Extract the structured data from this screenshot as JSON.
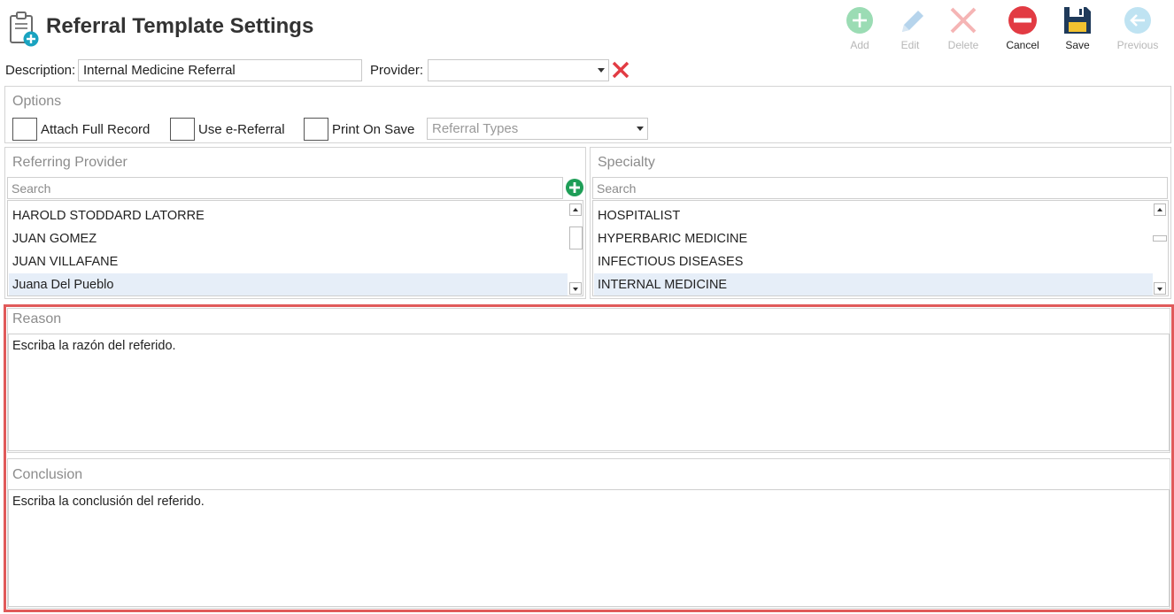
{
  "header": {
    "title": "Referral Template Settings",
    "icon": "clipboard-add-icon"
  },
  "toolbar": {
    "add_label": "Add",
    "edit_label": "Edit",
    "delete_label": "Delete",
    "cancel_label": "Cancel",
    "save_label": "Save",
    "previous_label": "Previous"
  },
  "form": {
    "description_label": "Description:",
    "description_value": "Internal Medicine Referral",
    "provider_label": "Provider:",
    "provider_value": ""
  },
  "options": {
    "title": "Options",
    "attach_full_record": {
      "label": "Attach Full Record",
      "checked": false
    },
    "use_e_referral": {
      "label": "Use e-Referral",
      "checked": false
    },
    "print_on_save": {
      "label": "Print On Save",
      "checked": false
    },
    "referral_types_placeholder": "Referral Types"
  },
  "referring_provider": {
    "title": "Referring Provider",
    "search_placeholder": "Search",
    "items": [
      {
        "label": "HAROLD STODDARD LATORRE",
        "selected": false
      },
      {
        "label": "JUAN GOMEZ",
        "selected": false
      },
      {
        "label": "JUAN VILLAFANE",
        "selected": false
      },
      {
        "label": "Juana  Del Pueblo",
        "selected": true
      }
    ]
  },
  "specialty": {
    "title": "Specialty",
    "search_placeholder": "Search",
    "items": [
      {
        "label": "HOSPITALIST",
        "selected": false
      },
      {
        "label": "HYPERBARIC MEDICINE",
        "selected": false
      },
      {
        "label": "INFECTIOUS DISEASES",
        "selected": false
      },
      {
        "label": "INTERNAL MEDICINE",
        "selected": true
      }
    ]
  },
  "reason": {
    "title": "Reason",
    "text": "Escriba la razón del referido."
  },
  "conclusion": {
    "title": "Conclusion",
    "text": "Escriba la conclusión del referido."
  },
  "colors": {
    "add_green": "#9bdcb4",
    "edit_blue": "#b6d4ec",
    "delete_red": "#f5b5b5",
    "cancel_red": "#e23b43",
    "save_navy": "#1f3a5a",
    "previous_blue": "#bfe3f2",
    "highlight": "#e05a5a",
    "selected_row": "#e6eef8",
    "plus_green": "#1e9e57"
  }
}
